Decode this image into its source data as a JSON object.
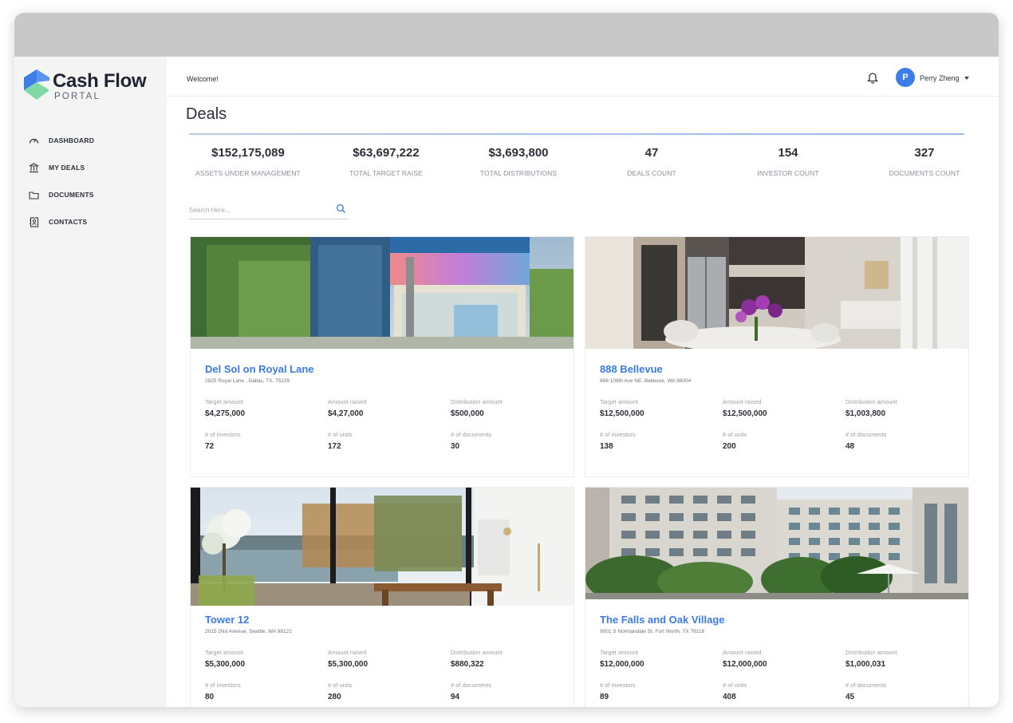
{
  "app": {
    "logo_title": "Cash Flow",
    "logo_subtitle": "PORTAL",
    "brand_colors": {
      "primary": "#3d7de8",
      "accent_blue": "#3b7be6",
      "accent_green": "#7ed9a4"
    }
  },
  "sidebar": {
    "items": [
      {
        "label": "DASHBOARD",
        "icon": "gauge-icon"
      },
      {
        "label": "MY DEALS",
        "icon": "bank-icon"
      },
      {
        "label": "DOCUMENTS",
        "icon": "folder-icon"
      },
      {
        "label": "CONTACTS",
        "icon": "contact-book-icon"
      }
    ]
  },
  "header": {
    "welcome": "Welcome!",
    "user": {
      "initial": "P",
      "name": "Perry Zheng"
    },
    "icons": [
      "bell-icon",
      "chevron-down-icon"
    ]
  },
  "page": {
    "title": "Deals",
    "stats": [
      {
        "value": "$152,175,089",
        "label": "ASSETS UNDER MANAGEMENT"
      },
      {
        "value": "$63,697,222",
        "label": "TOTAL TARGET RAISE"
      },
      {
        "value": "$3,693,800",
        "label": "TOTAL DISTRIBUTIONS"
      },
      {
        "value": "47",
        "label": "DEALS COUNT"
      },
      {
        "value": "154",
        "label": "INVESTOR COUNT"
      },
      {
        "value": "327",
        "label": "DOCUMENTS COUNT"
      }
    ],
    "search": {
      "placeholder": "Search Here...",
      "value": ""
    }
  },
  "metric_labels": {
    "target": "Target amount",
    "raised": "Amount raised",
    "distribution": "Distribution amount",
    "investors": "# of investors",
    "units": "# of units",
    "documents": "# of documents"
  },
  "deals": [
    {
      "name": "Del Sol on Royal Lane",
      "address": "2825 Royal Lane , Dallas, TX, 75229",
      "target": "$4,275,000",
      "raised": "$4,27,000",
      "distribution": "$500,000",
      "investors": "72",
      "units": "172",
      "documents": "30"
    },
    {
      "name": "888 Bellevue",
      "address": "888 108th Ave NE, Bellevue, WA 98004",
      "target": "$12,500,000",
      "raised": "$12,500,000",
      "distribution": "$1,003,800",
      "investors": "138",
      "units": "200",
      "documents": "48"
    },
    {
      "name": "Tower 12",
      "address": "2015 2Nd Avenue, Seattle, WA 98121",
      "target": "$5,300,000",
      "raised": "$5,300,000",
      "distribution": "$880,322",
      "investors": "80",
      "units": "280",
      "documents": "94"
    },
    {
      "name": "The Falls and Oak Village",
      "address": "9001 S Normandale St, Fort Worth, TX 76116",
      "target": "$12,000,000",
      "raised": "$12,000,000",
      "distribution": "$1,000,031",
      "investors": "89",
      "units": "408",
      "documents": "45"
    }
  ]
}
